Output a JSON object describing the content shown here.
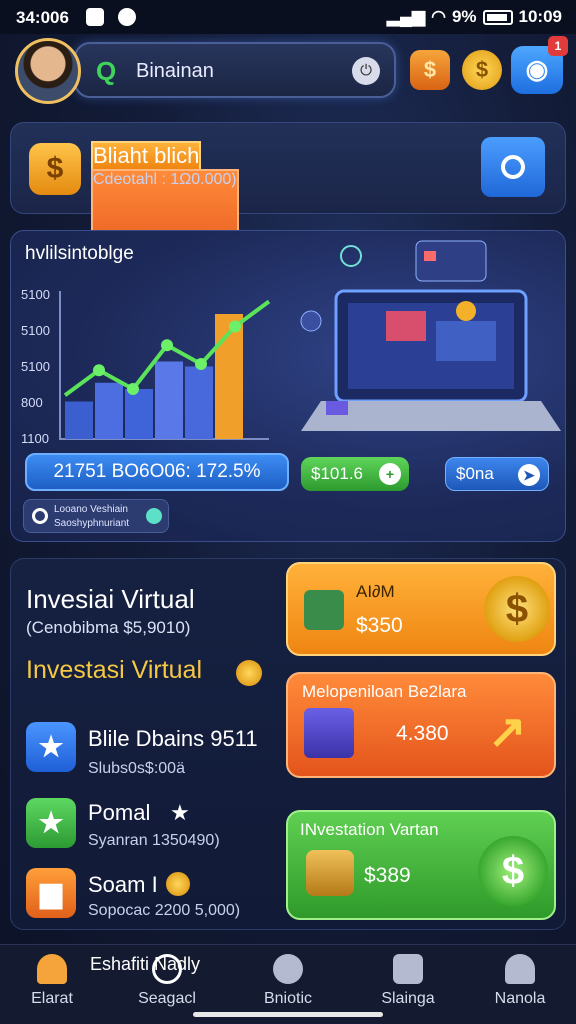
{
  "status_bar": {
    "time_left": "34:006",
    "battery": "9%",
    "time_right": "10:09"
  },
  "header": {
    "search_value": "Binainan",
    "badge": "1"
  },
  "balance": {
    "title": "Bliaht blich",
    "subtitle": "Cdeotahl : 1Ω0.000)"
  },
  "chart_card": {
    "title": "hvlilsintoblge",
    "pill_main": "21751 BO6O06: 172.5%",
    "pill_green": "$101.6",
    "pill_blue": "$0na",
    "mini_line1": "Looano Veshiain",
    "mini_line2": "Saoshyphnuriant"
  },
  "chart_data": {
    "type": "bar",
    "title": "hvlilsintoblge",
    "y_ticks": [
      "5100",
      "5100",
      "5100",
      "800",
      "1100"
    ],
    "values": [
      30,
      45,
      40,
      62,
      58,
      100
    ],
    "trend": [
      35,
      55,
      40,
      75,
      60,
      90,
      110
    ],
    "colors": [
      "#3b5fcf",
      "#4d6ee0",
      "#3f63d8",
      "#5a78e8",
      "#4769dc",
      "#f0a02a"
    ]
  },
  "panel": {
    "title": "Invesiai Virtual",
    "subtitle": "(Cenobibma $5,9010)",
    "title2": "Investasi Virtual",
    "items": [
      {
        "title": "Blile Dbains 9511",
        "sub": "Slubs0s$:00ä",
        "color": "#2f77f0",
        "icon": "star-icon"
      },
      {
        "title": "Pomal",
        "sub": "Syanran 1350490)",
        "color": "#39b54a",
        "icon": "star-icon"
      },
      {
        "title": "Soam I",
        "sub": "Sopocac 2200 5,000)",
        "color": "#f07a1c",
        "icon": "box-icon"
      }
    ],
    "tiles": [
      {
        "title": "AI∂M",
        "value": "$350"
      },
      {
        "title": "Melopeniloan Be2lara",
        "value": "4.380"
      },
      {
        "title": "INvestation Vartan",
        "value": "$389"
      }
    ]
  },
  "nav": {
    "tip": "Eshafiti   Nadly",
    "items": [
      "Elarat",
      "Seagacl",
      "Bniotic",
      "Slainga",
      "Nanola"
    ]
  }
}
